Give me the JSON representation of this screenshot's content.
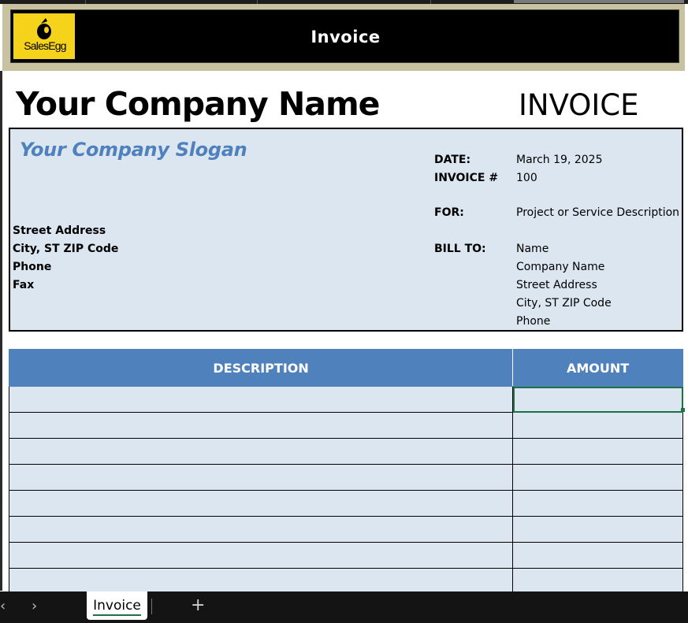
{
  "banner": {
    "logo_text": "SalesEgg",
    "title": "Invoice"
  },
  "header": {
    "company_name": "Your Company Name",
    "invoice_heading": "INVOICE"
  },
  "company": {
    "slogan": "Your Company Slogan",
    "street": "Street Address",
    "city": "City, ST  ZIP Code",
    "phone": "Phone",
    "fax": "Fax"
  },
  "meta": {
    "date_label": "DATE:",
    "date_value": "March 19, 2025",
    "invoice_label": "INVOICE #",
    "invoice_value": "100",
    "for_label": "FOR:",
    "for_value": "Project or Service Description",
    "bill_to_label": "BILL TO:",
    "bill_to": [
      "Name",
      "Company Name",
      "Street Address",
      "City, ST  ZIP Code",
      "Phone"
    ]
  },
  "table": {
    "columns": [
      "DESCRIPTION",
      "AMOUNT"
    ],
    "rows": [
      [
        "",
        ""
      ],
      [
        "",
        ""
      ],
      [
        "",
        ""
      ],
      [
        "",
        ""
      ],
      [
        "",
        ""
      ],
      [
        "",
        ""
      ],
      [
        "",
        ""
      ],
      [
        "",
        ""
      ]
    ]
  },
  "sheet_tabs": {
    "active": "Invoice",
    "prev_icon": "‹",
    "next_icon": "›",
    "add_icon": "+"
  },
  "colors": {
    "header_blue": "#4f81bd",
    "cell_fill": "#dce6f1",
    "logo_yellow": "#f6d31b"
  }
}
